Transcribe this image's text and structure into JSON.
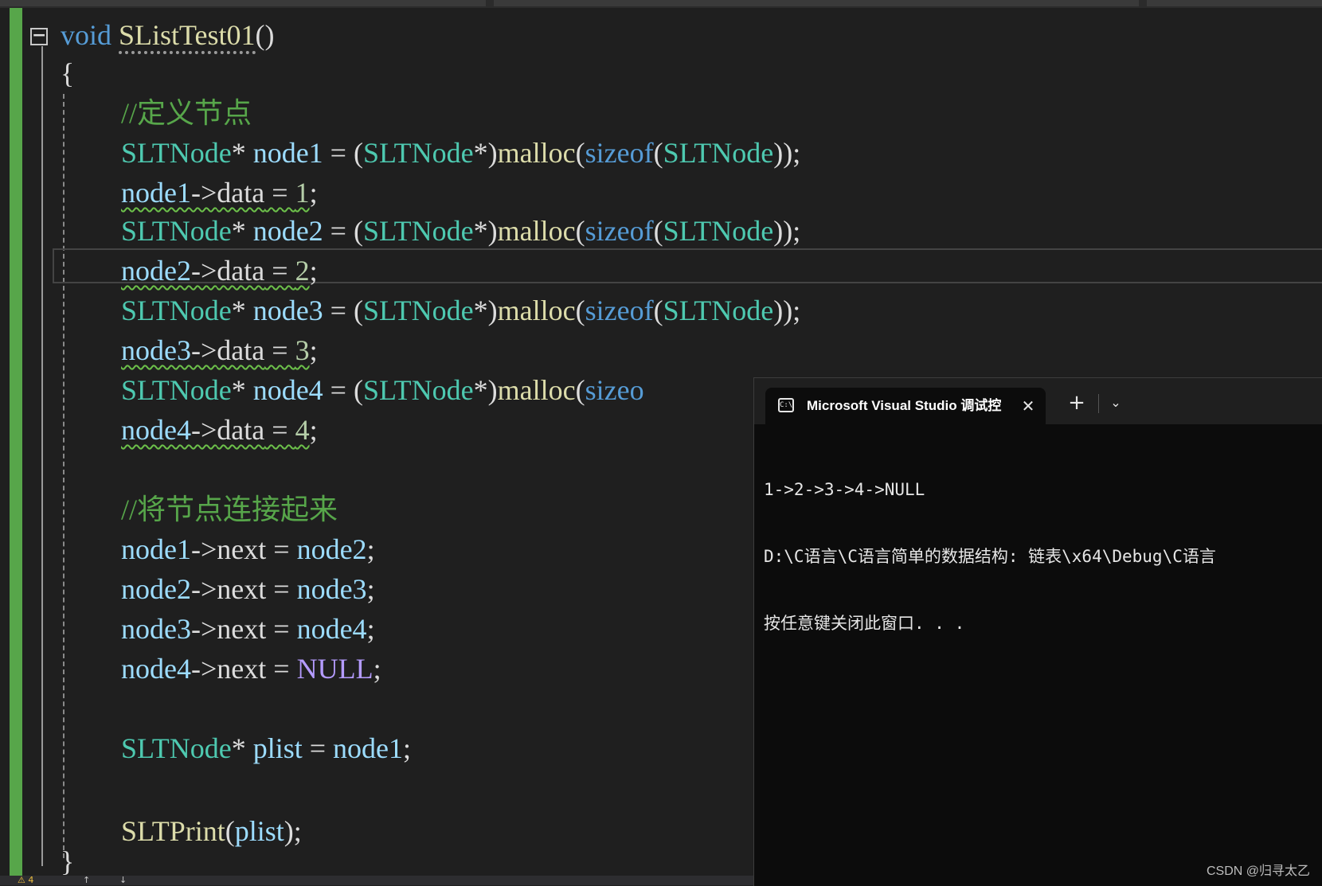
{
  "editor": {
    "line1": {
      "kw": "void",
      "fn": "SListTest01",
      "p": "()"
    },
    "line2": {
      "p": "{"
    },
    "line3": {
      "cm": "//定义节点"
    },
    "line4": {
      "ty1": "SLTNode",
      "p1": "* ",
      "id1": "node1",
      "p2": " = (",
      "ty2": "SLTNode",
      "p3": "*)",
      "fn": "malloc",
      "p4": "(",
      "kw": "sizeof",
      "p5": "(",
      "ty3": "SLTNode",
      "p6": "));"
    },
    "line5": {
      "id": "node1",
      "p1": "->",
      "fld": "data",
      "p2": " = ",
      "nu": "1",
      "p3": ";"
    },
    "line6": {
      "ty1": "SLTNode",
      "p1": "* ",
      "id1": "node2",
      "p2": " = (",
      "ty2": "SLTNode",
      "p3": "*)",
      "fn": "malloc",
      "p4": "(",
      "kw": "sizeof",
      "p5": "(",
      "ty3": "SLTNode",
      "p6": "));"
    },
    "line7": {
      "id": "node2",
      "p1": "->",
      "fld": "data",
      "p2": " = ",
      "nu": "2",
      "p3": ";"
    },
    "line8": {
      "ty1": "SLTNode",
      "p1": "* ",
      "id1": "node3",
      "p2": " = (",
      "ty2": "SLTNode",
      "p3": "*)",
      "fn": "malloc",
      "p4": "(",
      "kw": "sizeof",
      "p5": "(",
      "ty3": "SLTNode",
      "p6": "));"
    },
    "line9": {
      "id": "node3",
      "p1": "->",
      "fld": "data",
      "p2": " = ",
      "nu": "3",
      "p3": ";"
    },
    "line10": {
      "ty1": "SLTNode",
      "p1": "* ",
      "id1": "node4",
      "p2": " = (",
      "ty2": "SLTNode",
      "p3": "*)",
      "fn": "malloc",
      "p4": "(",
      "kw": "sizeo"
    },
    "line11": {
      "id": "node4",
      "p1": "->",
      "fld": "data",
      "p2": " = ",
      "nu": "4",
      "p3": ";"
    },
    "line12": {
      "cm": "//将节点连接起来"
    },
    "line13": {
      "id1": "node1",
      "p1": "->",
      "fld": "next",
      "p2": " = ",
      "id2": "node2",
      "p3": ";"
    },
    "line14": {
      "id1": "node2",
      "p1": "->",
      "fld": "next",
      "p2": " = ",
      "id2": "node3",
      "p3": ";"
    },
    "line15": {
      "id1": "node3",
      "p1": "->",
      "fld": "next",
      "p2": " = ",
      "id2": "node4",
      "p3": ";"
    },
    "line16": {
      "id1": "node4",
      "p1": "->",
      "fld": "next",
      "p2": " = ",
      "ma": "NULL",
      "p3": ";"
    },
    "line17": {
      "ty": "SLTNode",
      "p1": "* ",
      "id1": "plist",
      "p2": " = ",
      "id2": "node1",
      "p3": ";"
    },
    "line18": {
      "fn": "SLTPrint",
      "p1": "(",
      "id": "plist",
      "p2": ");"
    },
    "line19": {
      "p": "}"
    }
  },
  "status": {
    "warnings": "⚠ 4",
    "up": "↑",
    "down": "↓"
  },
  "terminal": {
    "tab_title": "Microsoft Visual Studio 调试控",
    "close_glyph": "✕",
    "new_tab_glyph": "+",
    "dropdown_glyph": "⌄",
    "icon_text": "C:\\",
    "output": [
      "1->2->3->4->NULL",
      "D:\\C语言\\C语言简单的数据结构: 链表\\x64\\Debug\\C语言",
      "按任意键关闭此窗口. . ."
    ]
  },
  "watermark": "CSDN @归寻太乙"
}
